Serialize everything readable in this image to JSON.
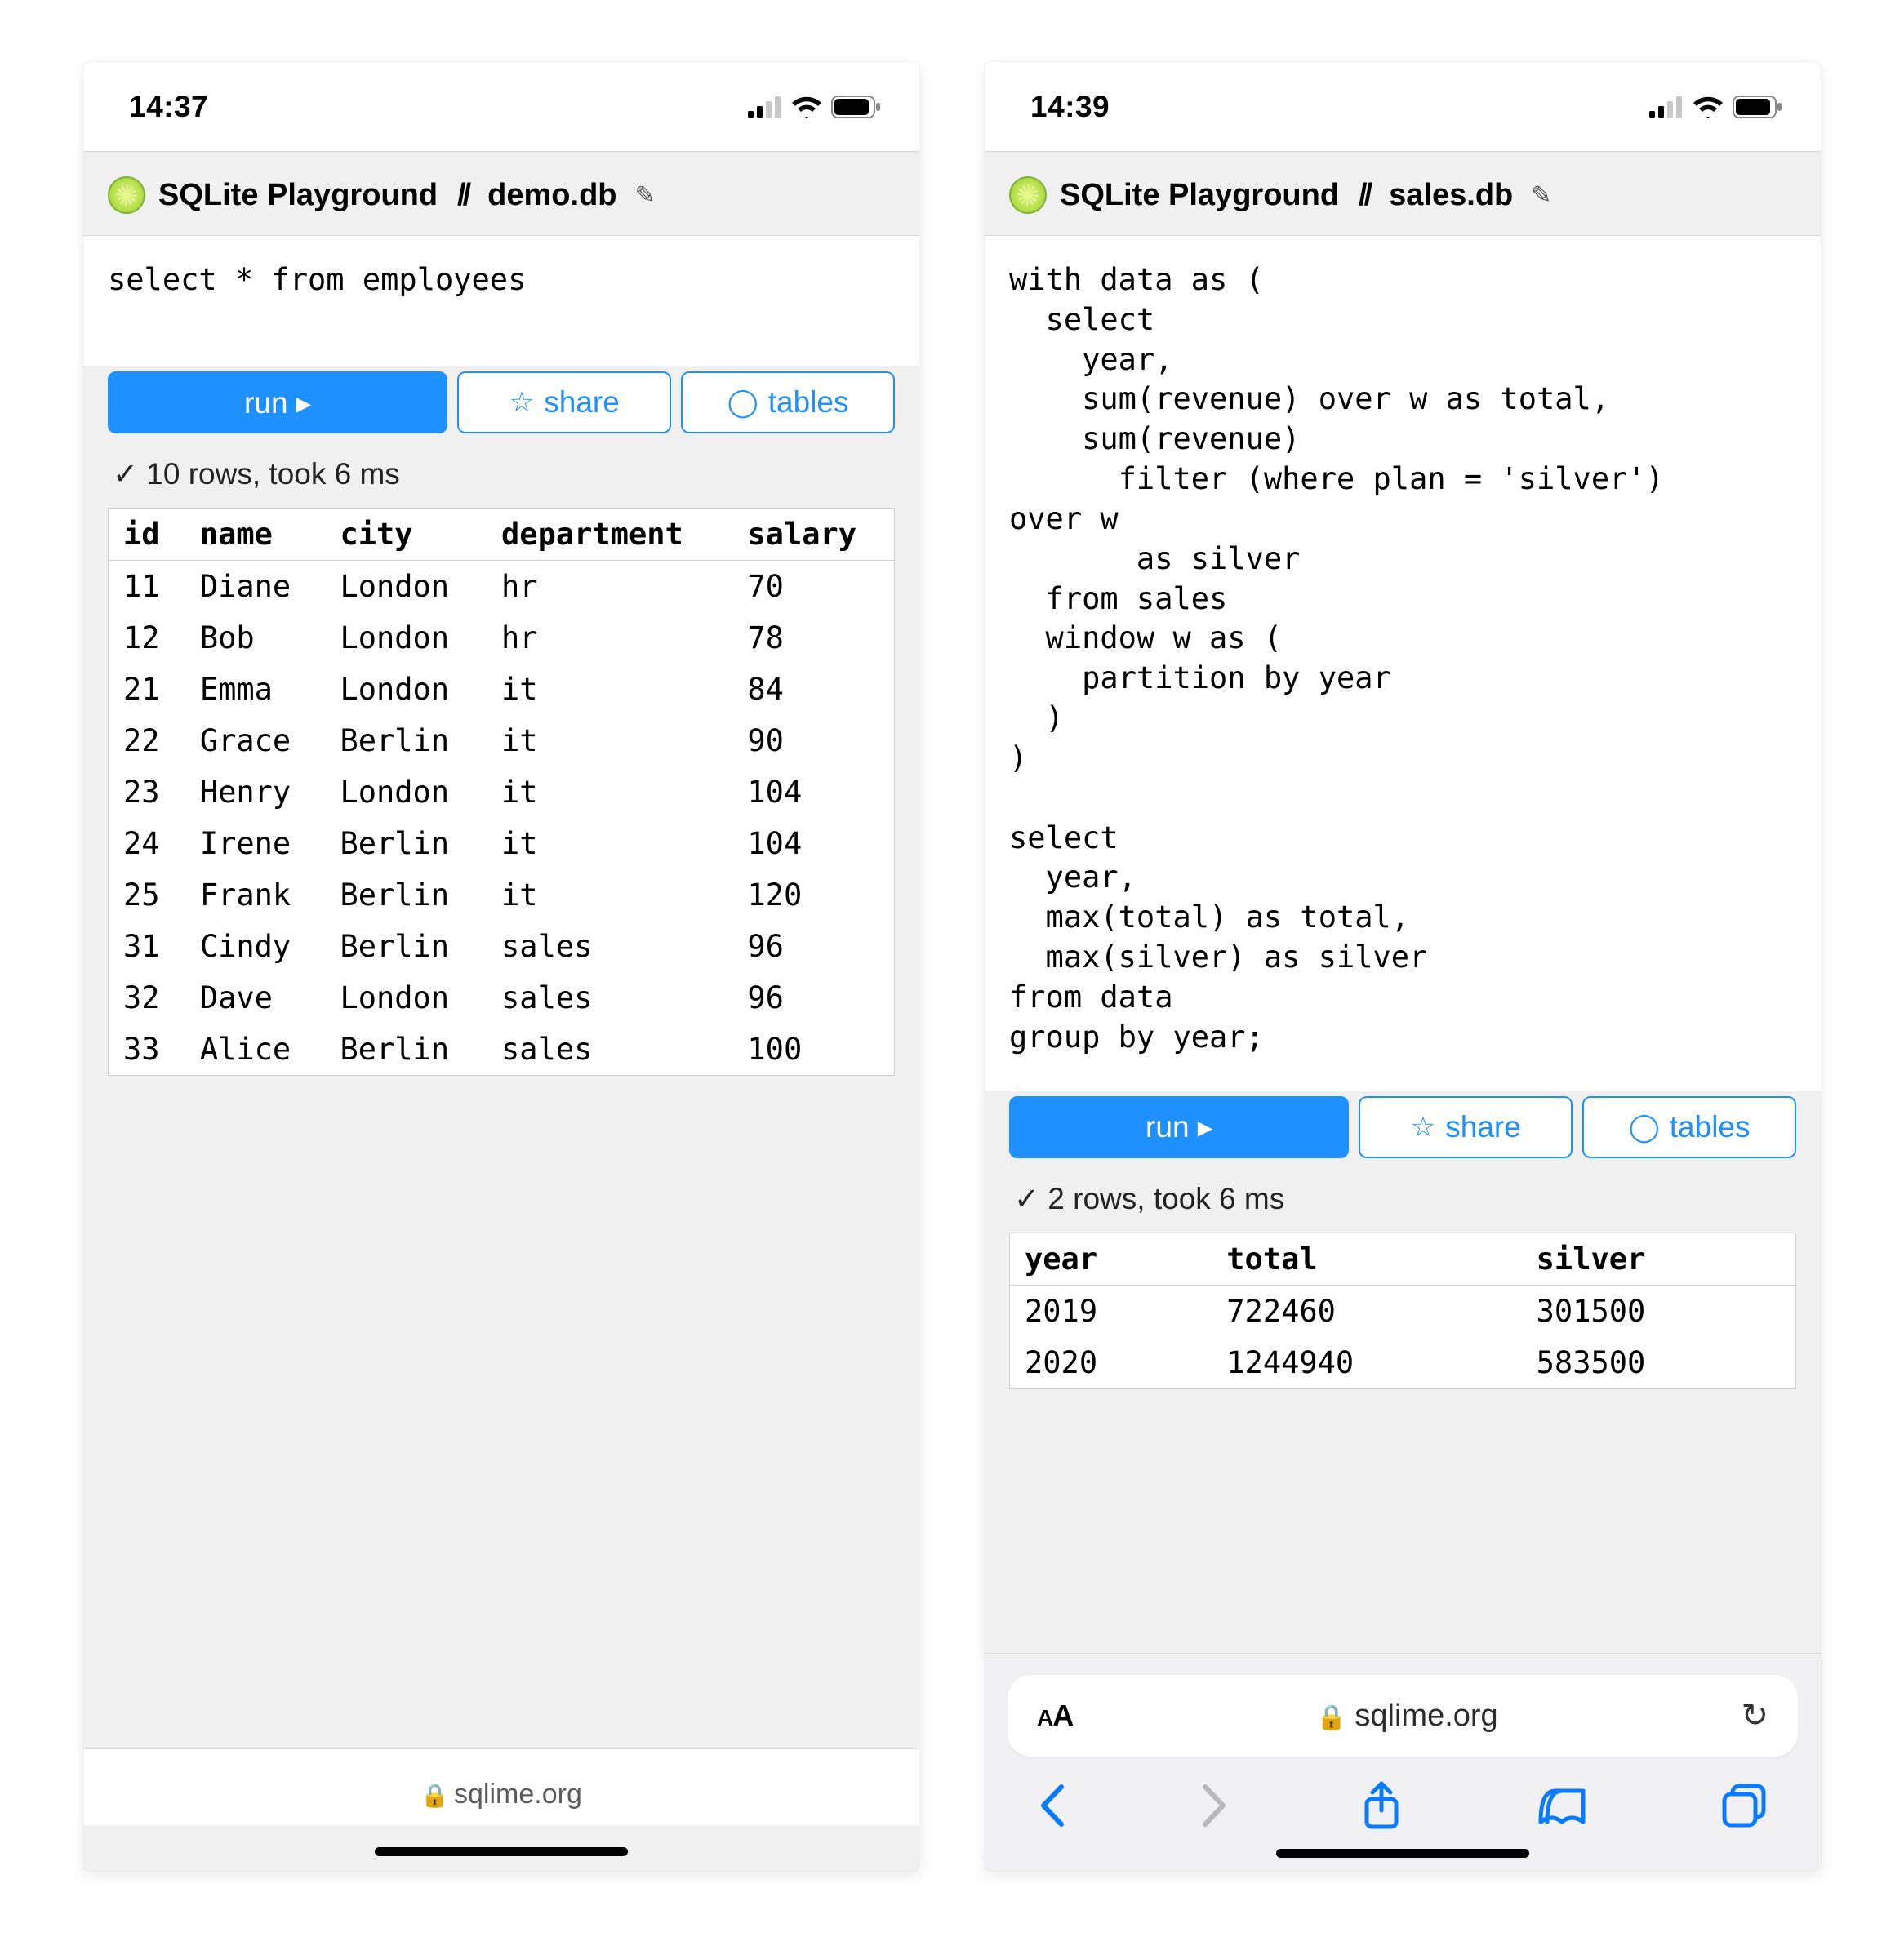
{
  "phone1": {
    "status_time": "14:37",
    "app_title": "SQLite Playground",
    "separator": "//",
    "db_name": "demo.db",
    "sql": "select * from employees",
    "buttons": {
      "run": "run ▸",
      "share": "share",
      "tables": "tables"
    },
    "result_summary": "10 rows, took 6 ms",
    "columns": [
      "id",
      "name",
      "city",
      "department",
      "salary"
    ],
    "rows": [
      {
        "id": "11",
        "name": "Diane",
        "city": "London",
        "department": "hr",
        "salary": "70"
      },
      {
        "id": "12",
        "name": "Bob",
        "city": "London",
        "department": "hr",
        "salary": "78"
      },
      {
        "id": "21",
        "name": "Emma",
        "city": "London",
        "department": "it",
        "salary": "84"
      },
      {
        "id": "22",
        "name": "Grace",
        "city": "Berlin",
        "department": "it",
        "salary": "90"
      },
      {
        "id": "23",
        "name": "Henry",
        "city": "London",
        "department": "it",
        "salary": "104"
      },
      {
        "id": "24",
        "name": "Irene",
        "city": "Berlin",
        "department": "it",
        "salary": "104"
      },
      {
        "id": "25",
        "name": "Frank",
        "city": "Berlin",
        "department": "it",
        "salary": "120"
      },
      {
        "id": "31",
        "name": "Cindy",
        "city": "Berlin",
        "department": "sales",
        "salary": "96"
      },
      {
        "id": "32",
        "name": "Dave",
        "city": "London",
        "department": "sales",
        "salary": "96"
      },
      {
        "id": "33",
        "name": "Alice",
        "city": "Berlin",
        "department": "sales",
        "salary": "100"
      }
    ],
    "url": "sqlime.org"
  },
  "phone2": {
    "status_time": "14:39",
    "app_title": "SQLite Playground",
    "separator": "//",
    "db_name": "sales.db",
    "sql": "with data as (\n  select\n    year,\n    sum(revenue) over w as total,\n    sum(revenue)\n      filter (where plan = 'silver')\nover w\n       as silver\n  from sales\n  window w as (\n    partition by year\n  )\n)\n\nselect\n  year,\n  max(total) as total,\n  max(silver) as silver\nfrom data\ngroup by year;",
    "buttons": {
      "run": "run ▸",
      "share": "share",
      "tables": "tables"
    },
    "result_summary": "2 rows, took 6 ms",
    "columns": [
      "year",
      "total",
      "silver"
    ],
    "rows": [
      {
        "year": "2019",
        "total": "722460",
        "silver": "301500"
      },
      {
        "year": "2020",
        "total": "1244940",
        "silver": "583500"
      }
    ],
    "url": "sqlime.org"
  }
}
